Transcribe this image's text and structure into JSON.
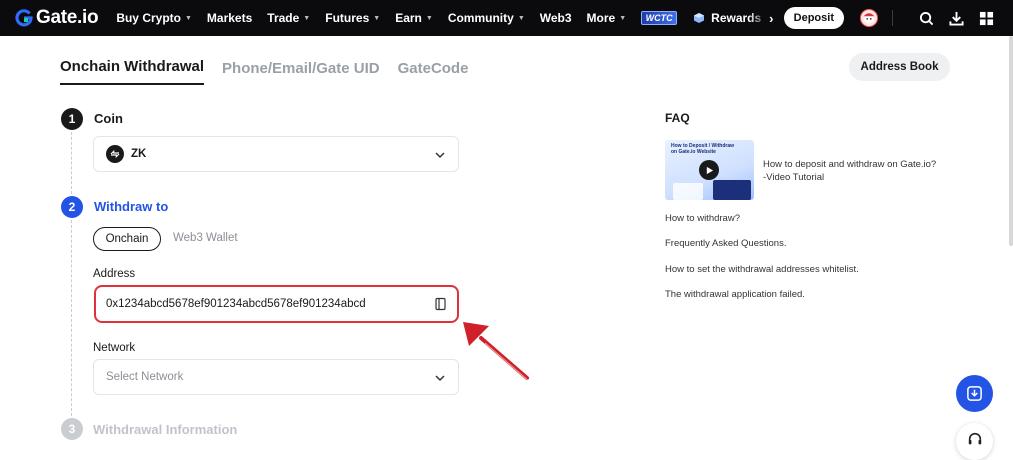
{
  "nav": {
    "logo_text": "Gate.io",
    "items": [
      {
        "label": "Buy Crypto",
        "caret": true
      },
      {
        "label": "Markets",
        "caret": false
      },
      {
        "label": "Trade",
        "caret": true
      },
      {
        "label": "Futures",
        "caret": true
      },
      {
        "label": "Earn",
        "caret": true
      },
      {
        "label": "Community",
        "caret": true
      },
      {
        "label": "Web3",
        "caret": false
      },
      {
        "label": "More",
        "caret": true
      }
    ],
    "wctc_label": "WCTC",
    "rewards_label": "Rewards",
    "deposit_label": "Deposit"
  },
  "tabs": [
    {
      "label": "Onchain Withdrawal",
      "active": true
    },
    {
      "label": "Phone/Email/Gate UID",
      "active": false
    },
    {
      "label": "GateCode",
      "active": false
    }
  ],
  "address_book_label": "Address Book",
  "steps": {
    "coin": {
      "number": "1",
      "title": "Coin",
      "selected": "ZK"
    },
    "withdraw_to": {
      "number": "2",
      "title": "Withdraw to",
      "options": [
        "Onchain",
        "Web3 Wallet"
      ],
      "address_label": "Address",
      "address_value": "0x1234abcd5678ef901234abcd5678ef901234abcd",
      "network_label": "Network",
      "network_placeholder": "Select Network"
    },
    "withdrawal_info": {
      "number": "3",
      "title": "Withdrawal Information"
    }
  },
  "faq": {
    "title": "FAQ",
    "thumbnail_text": "How to Deposit / Withdraw on Gate.io Website",
    "video_title_line1": "How to deposit and withdraw on Gate.io?",
    "video_title_line2": "-Video Tutorial",
    "links": [
      "How to withdraw?",
      "Frequently Asked Questions.",
      "How to set the withdrawal addresses whitelist.",
      "The withdrawal application failed."
    ]
  },
  "colors": {
    "accent": "#2354e6",
    "highlight": "#e0303a",
    "nav_bg": "#0b0b0e"
  }
}
